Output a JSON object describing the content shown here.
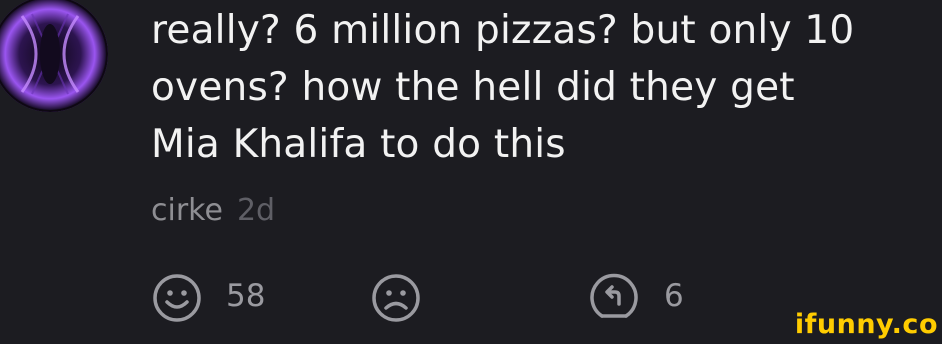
{
  "comment": {
    "text": "really? 6 million pizzas? but only 10\novens? how the hell did they get\nMia Khalifa to do this",
    "author": "cirke",
    "time": "2d"
  },
  "actions": {
    "smile_count": "58",
    "reply_count": "6"
  },
  "brand": {
    "watermark": "ifunny.co"
  },
  "colors": {
    "background": "#1c1c21",
    "text": "#f2f2f2",
    "meta": "#8e8e93",
    "icon": "#9a9aa0",
    "watermark": "#ffcc00",
    "avatar_accent": "#b06cff"
  },
  "icons": {
    "smile": "smile-icon",
    "unsmile": "frown-icon",
    "reply": "reply-icon"
  }
}
